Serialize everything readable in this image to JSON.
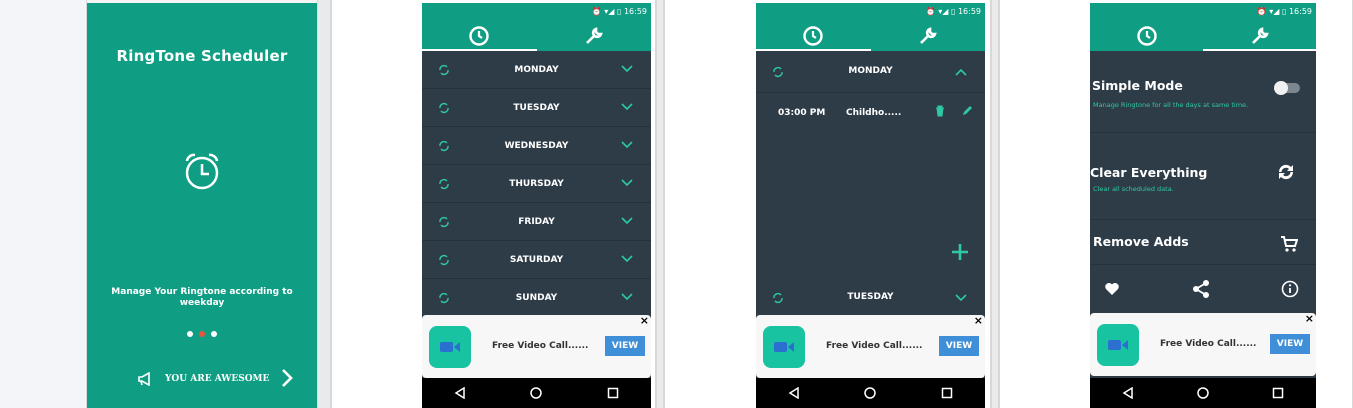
{
  "splash": {
    "title": "RingTone Scheduler",
    "tagline": "Manage Your Ringtone according to weekday",
    "cta": "YOU ARE AWESOME",
    "page_dots": 3,
    "active_dot": 2
  },
  "status_bar": {
    "time": "16:59"
  },
  "tabs": {
    "schedule": "clock-icon",
    "settings": "wrench-icon"
  },
  "days": [
    "MONDAY",
    "TUESDAY",
    "WEDNESDAY",
    "THURSDAY",
    "FRIDAY",
    "SATURDAY",
    "SUNDAY"
  ],
  "expanded": {
    "day": "MONDAY",
    "entry_time": "03:00 PM",
    "entry_song": "Childho.....",
    "next_day": "TUESDAY"
  },
  "settings": {
    "simple_mode": {
      "title": "Simple Mode",
      "subtitle": "Manage Ringtone for all the days at same time.",
      "enabled": false
    },
    "clear": {
      "title": "Clear Everything",
      "subtitle": "Clear all scheduled data."
    },
    "remove_ads": {
      "title": "Remove Adds"
    }
  },
  "ad": {
    "text": "Free Video Call......",
    "button": "VIEW",
    "close": "×"
  },
  "colors": {
    "teal": "#0f9e83",
    "dark": "#2e3c48",
    "accent": "#2ec9a2",
    "button": "#3f8fd8"
  }
}
